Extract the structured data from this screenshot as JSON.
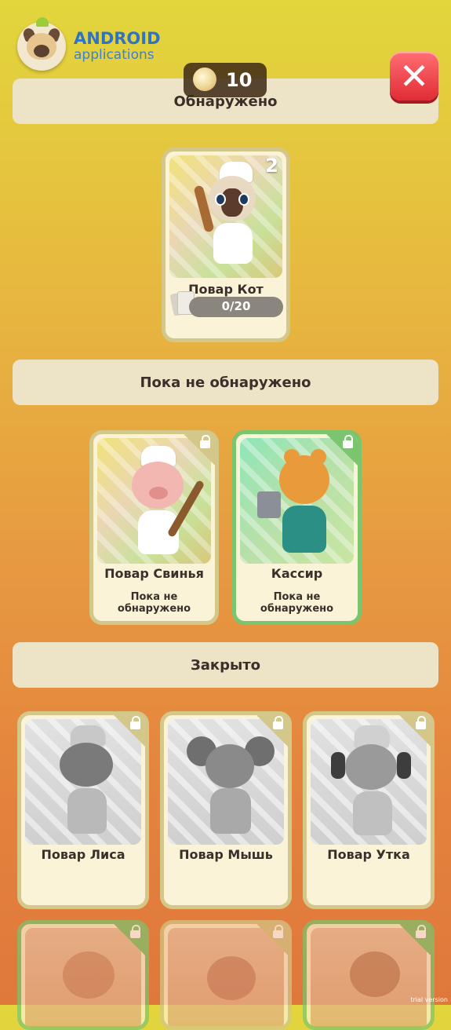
{
  "watermark": {
    "line1": "ANDROID",
    "line2": "applications",
    "icon": "pug-droid-icon"
  },
  "currency": {
    "value": "10",
    "icon": "popcorn-icon"
  },
  "close_icon": "close-icon",
  "sections": {
    "discovered": "Обнаружено",
    "not_discovered": "Пока не обнаружено",
    "locked": "Закрыто"
  },
  "discovered_cards": [
    {
      "name": "Повар Кот",
      "count": "2",
      "progress_text": "0/20",
      "progress": 0,
      "icon": "chef-cat"
    }
  ],
  "not_discovered_cards": [
    {
      "name": "Повар Свинья",
      "status": "Пока не обнаружено",
      "icon": "chef-pig",
      "frame": "gold"
    },
    {
      "name": "Кассир",
      "status": "Пока не обнаружено",
      "icon": "cashier-bear",
      "frame": "green"
    }
  ],
  "locked_cards": [
    {
      "name": "Повар Лиса",
      "icon": "chef-fox"
    },
    {
      "name": "Повар Мышь",
      "icon": "chef-mouse"
    },
    {
      "name": "Повар Утка",
      "icon": "chef-duck"
    }
  ],
  "locked_cards_row2": [
    {
      "icon": "character-1"
    },
    {
      "icon": "character-2"
    },
    {
      "icon": "character-3"
    }
  ],
  "footer": {
    "trial": "trial version"
  },
  "colors": {
    "close": "#e12c35",
    "banner": "#ede3c6",
    "green_frame": "#7bc56f",
    "gold_frame": "#d3c78a"
  }
}
